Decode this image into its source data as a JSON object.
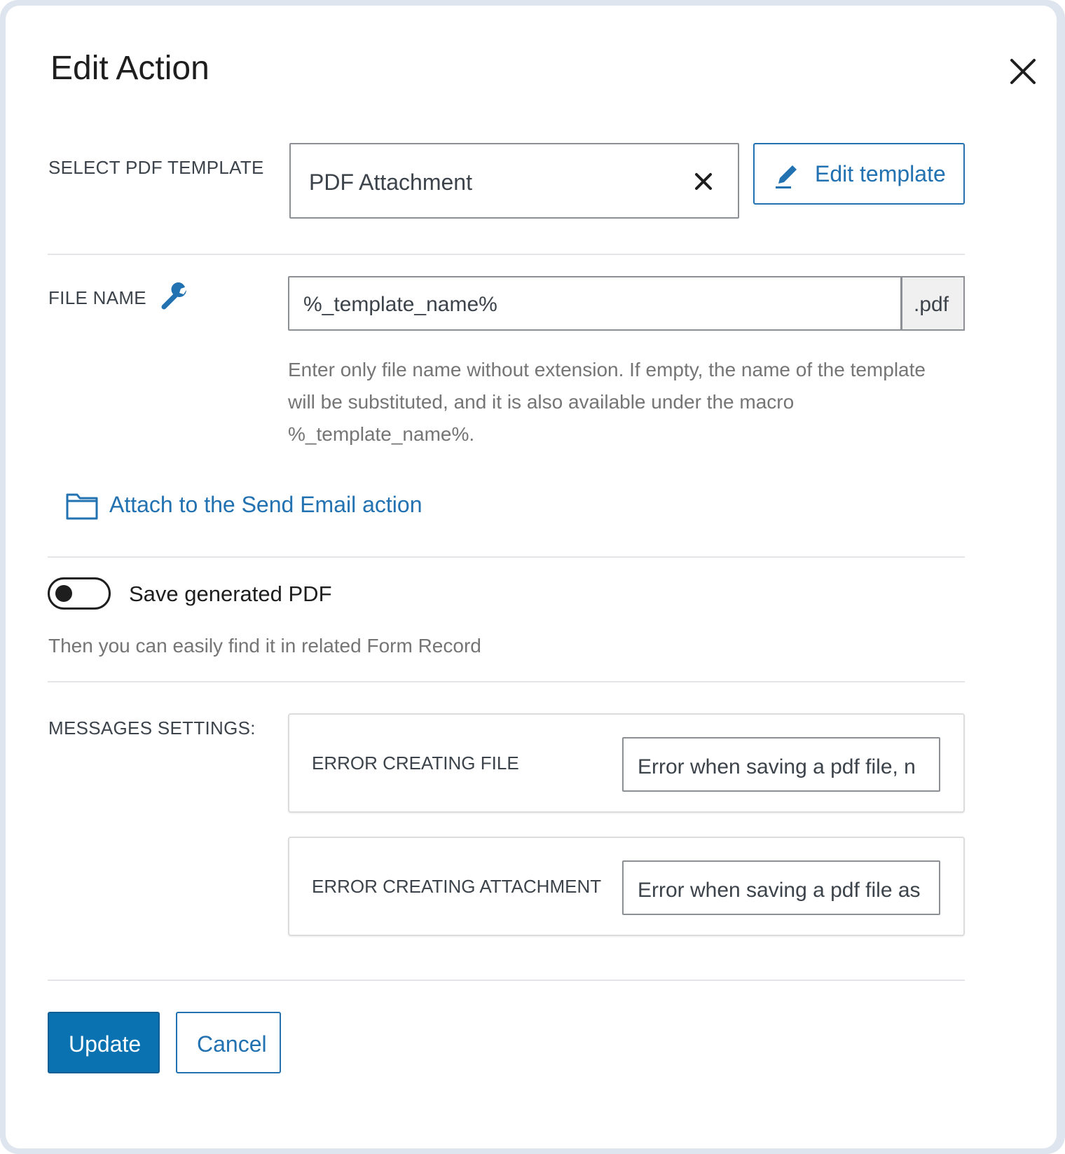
{
  "dialog": {
    "title": "Edit Action",
    "close_icon": "close-icon"
  },
  "template_section": {
    "label": "SELECT PDF TEMPLATE",
    "selected_value": "PDF Attachment",
    "clear_icon": "clear-x-icon",
    "edit_button_label": "Edit template",
    "edit_icon": "pencil-icon"
  },
  "file_name_section": {
    "label": "FILE NAME",
    "macro_icon": "wrench-icon",
    "value": "%_template_name%",
    "extension": ".pdf",
    "help_line1": "Enter only file name without extension. If empty, the name of the template",
    "help_line2": "will be substituted, and it is also available under the macro",
    "help_line3": "%_template_name%."
  },
  "attach_link": {
    "label": "Attach to the Send Email action",
    "icon": "folder-icon"
  },
  "save_pdf": {
    "toggle_label": "Save generated PDF",
    "toggle_on": false,
    "help": "Then you can easily find it in related Form Record"
  },
  "messages_settings": {
    "label": "MESSAGES SETTINGS:",
    "items": [
      {
        "label": "ERROR CREATING FILE",
        "value": "Error when saving a pdf file, n"
      },
      {
        "label": "ERROR CREATING ATTACHMENT",
        "value": "Error when saving a pdf file as"
      }
    ]
  },
  "footer": {
    "update_label": "Update",
    "cancel_label": "Cancel"
  },
  "colors": {
    "accent": "#2271b1",
    "primary_button": "#0a72b1",
    "frame": "#dfe5ee"
  }
}
